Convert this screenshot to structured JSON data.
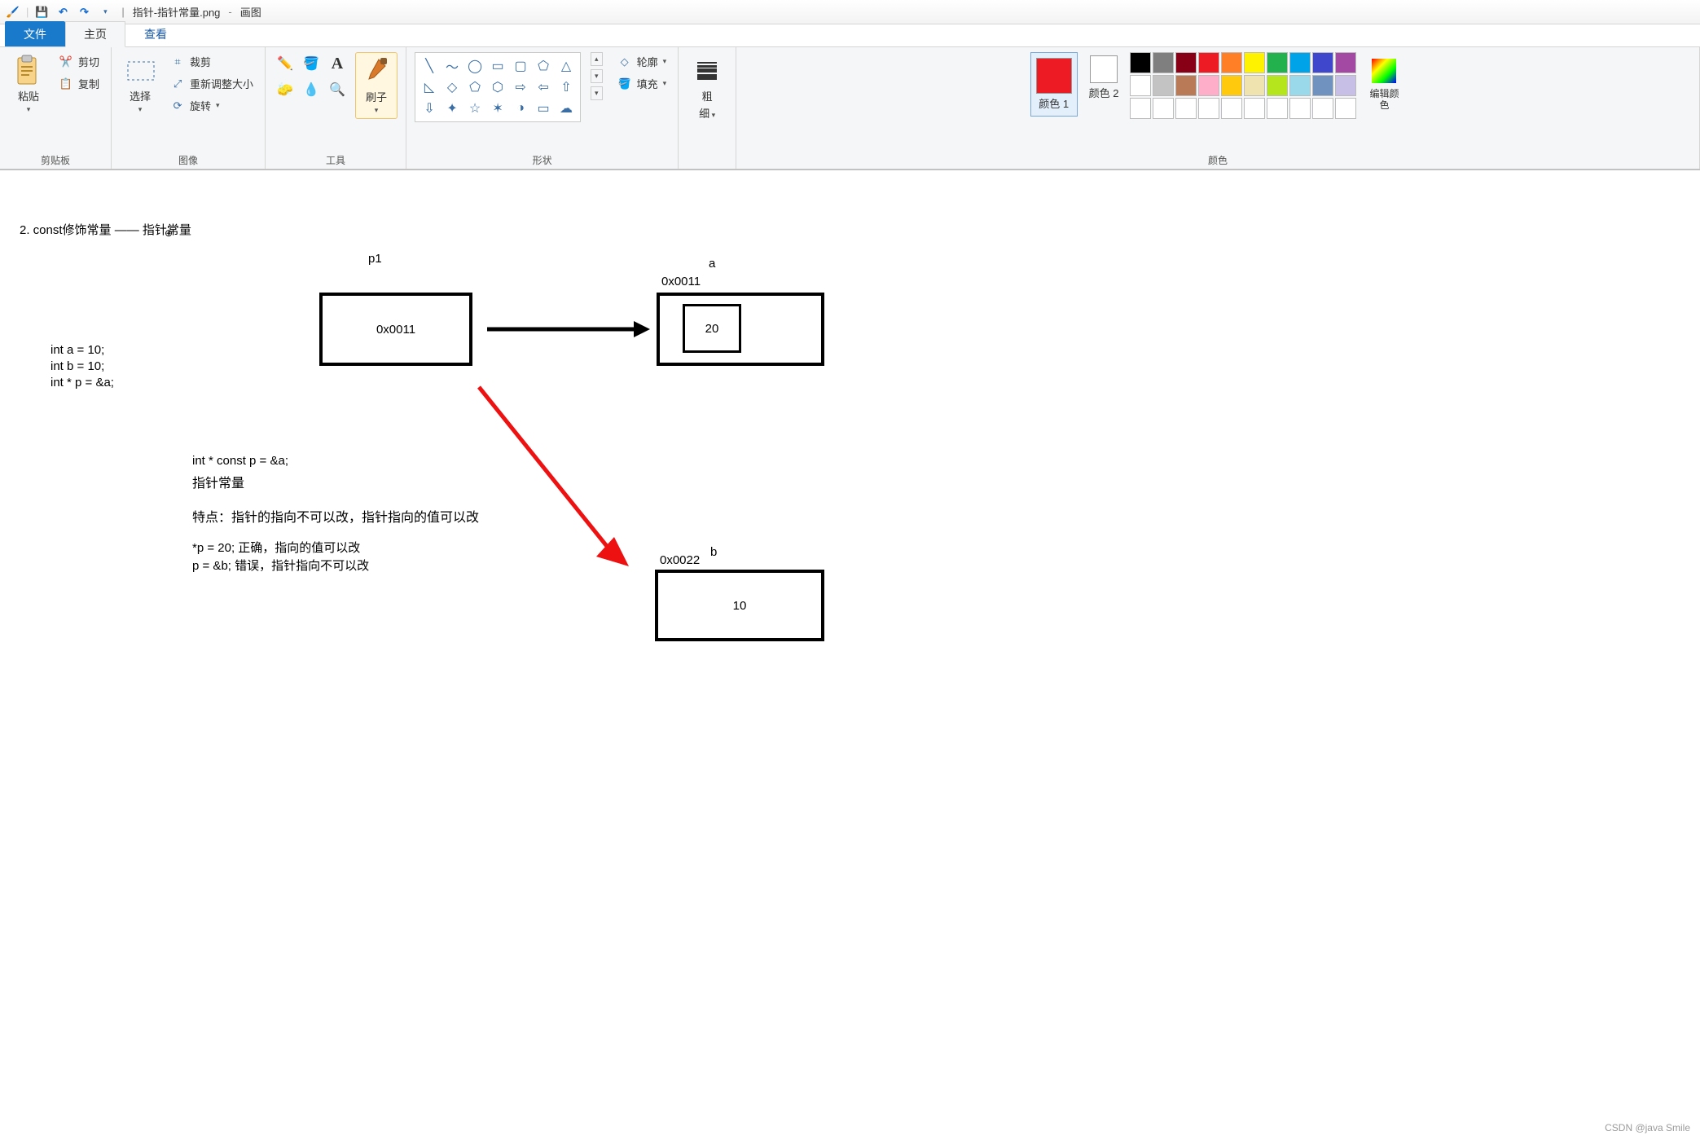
{
  "title": {
    "filename": "指针-指针常量.png",
    "app": "画图"
  },
  "tabs": {
    "file": "文件",
    "home": "主页",
    "view": "查看"
  },
  "ribbon": {
    "clipboard": {
      "paste": "粘贴",
      "cut": "剪切",
      "copy": "复制",
      "label": "剪贴板"
    },
    "image": {
      "select": "选择",
      "crop": "裁剪",
      "resize": "重新调整大小",
      "rotate": "旋转",
      "label": "图像"
    },
    "tools": {
      "brush": "刷子",
      "label": "工具"
    },
    "shapes": {
      "outline": "轮廓",
      "fill": "填充",
      "label": "形状"
    },
    "stroke": {
      "label_top": "粗",
      "label_bot": "细"
    },
    "colors": {
      "color1": "颜色 1",
      "color2": "颜色 2",
      "edit": "编辑颜色",
      "label": "颜色"
    }
  },
  "colors_row1": [
    "#000000",
    "#7f7f7f",
    "#880015",
    "#ed1c24",
    "#ff7f27",
    "#fff200",
    "#22b14c",
    "#00a2e8",
    "#3f48cc",
    "#a349a4"
  ],
  "colors_row2": [
    "#ffffff",
    "#c3c3c3",
    "#b97a57",
    "#ffaec9",
    "#ffc90e",
    "#efe4b0",
    "#b5e61d",
    "#99d9ea",
    "#7092be",
    "#c8bfe7"
  ],
  "canvas": {
    "heading": "2. const修饰常量  —— 指针常量",
    "p1": "p1",
    "a": "a",
    "b": "b",
    "addr_a": "0x0011",
    "addr_b": "0x0022",
    "val_p": "0x0011",
    "val_a": "20",
    "val_b": "10",
    "code1": "int a = 10;",
    "code2": "int b = 10;",
    "code3": "int * p = &a;",
    "decl": "int * const p = &a;",
    "name": "指针常量",
    "feature": "特点：指针的指向不可以改，指针指向的值可以改",
    "ex1": "*p = 20;   正确，指向的值可以改",
    "ex2": "p = &b;    错误，指针指向不可以改"
  },
  "watermark": "CSDN @java Smile"
}
